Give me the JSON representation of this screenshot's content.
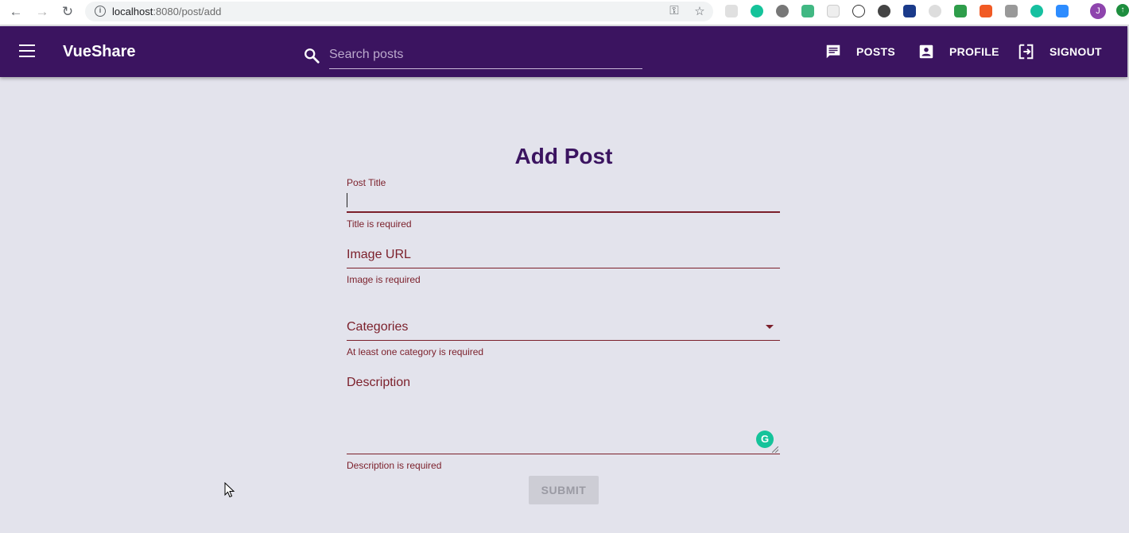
{
  "browser": {
    "url_host": "localhost",
    "url_rest": ":8080/post/add",
    "avatar_letter": "J"
  },
  "toolbar": {
    "app_title": "VueShare",
    "search_placeholder": "Search posts",
    "nav": [
      {
        "label": "POSTS",
        "icon": "chat-message-icon"
      },
      {
        "label": "PROFILE",
        "icon": "account-box-icon"
      },
      {
        "label": "SIGNOUT",
        "icon": "exit-to-app-icon"
      }
    ],
    "color": "#3b1460"
  },
  "form": {
    "title": "Add Post",
    "post_title": {
      "label": "Post Title",
      "value": "",
      "error": "Title is required"
    },
    "image_url": {
      "label": "Image URL",
      "value": "",
      "error": "Image is required"
    },
    "categories": {
      "label": "Categories",
      "error": "At least one category is required"
    },
    "description": {
      "label": "Description",
      "value": "",
      "error": "Description is required"
    },
    "submit_label": "SUBMIT",
    "error_color": "#7b1f2a"
  }
}
